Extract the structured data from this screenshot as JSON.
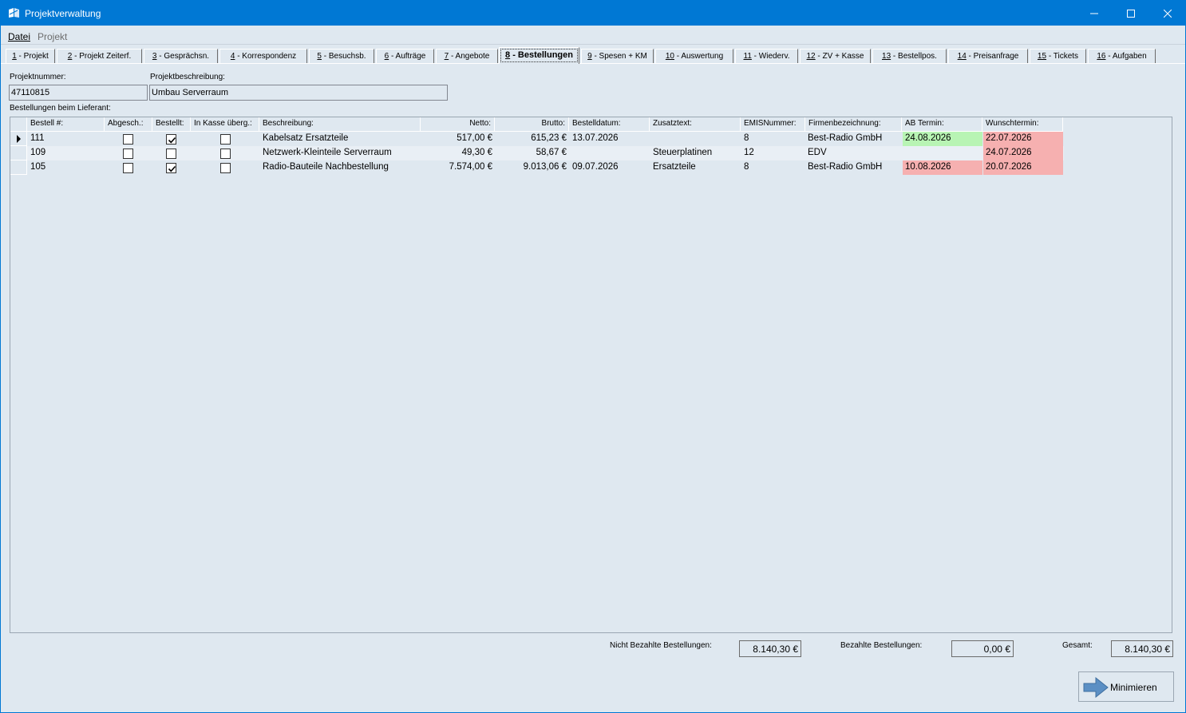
{
  "window": {
    "title": "Projektverwaltung"
  },
  "menu": {
    "datei": "Datei",
    "projekt": "Projekt"
  },
  "tabs": [
    {
      "num": "1",
      "label": " - Projekt"
    },
    {
      "num": "2",
      "label": " - Projekt Zeiterf."
    },
    {
      "num": "3",
      "label": " - Gesprächsn."
    },
    {
      "num": "4",
      "label": " - Korrespondenz"
    },
    {
      "num": "5",
      "label": " - Besuchsb."
    },
    {
      "num": "6",
      "label": " - Aufträge"
    },
    {
      "num": "7",
      "label": " - Angebote"
    },
    {
      "num": "8",
      "label": " - Bestellungen"
    },
    {
      "num": "9",
      "label": " - Spesen + KM"
    },
    {
      "num": "10",
      "label": " - Auswertung"
    },
    {
      "num": "11",
      "label": " - Wiederv."
    },
    {
      "num": "12",
      "label": " - ZV + Kasse"
    },
    {
      "num": "13",
      "label": " - Bestellpos."
    },
    {
      "num": "14",
      "label": " - Preisanfrage"
    },
    {
      "num": "15",
      "label": " - Tickets"
    },
    {
      "num": "16",
      "label": " - Aufgaben"
    }
  ],
  "form": {
    "projektnummer_label": "Projektnummer:",
    "projektnummer": "47110815",
    "beschreibung_label": "Projektbeschreibung:",
    "beschreibung": "Umbau Serverraum",
    "grid_label": "Bestellungen beim Lieferant:"
  },
  "grid": {
    "headers": {
      "bestell": "Bestell #:",
      "abgesch": "Abgesch.:",
      "bestellt": "Bestellt:",
      "kasse": "In Kasse überg.:",
      "beschreibung": "Beschreibung:",
      "netto": "Netto:",
      "brutto": "Brutto:",
      "datum": "Bestelldatum:",
      "zusatz": "Zusatztext:",
      "emis": "EMISNummer:",
      "firma": "Firmenbezeichnung:",
      "ab": "AB Termin:",
      "wunsch": "Wunschtermin:"
    },
    "rows": [
      {
        "bestell": "111",
        "abgesch": false,
        "bestellt": true,
        "kasse": false,
        "beschreibung": "Kabelsatz Ersatzteile",
        "netto": "517,00 €",
        "brutto": "615,23 €",
        "datum": "13.07.2026",
        "zusatz": "",
        "emis": "8",
        "firma": "Best-Radio GmbH",
        "ab": "24.08.2026",
        "ab_status": "green",
        "wunsch": "22.07.2026",
        "wunsch_status": "red"
      },
      {
        "bestell": "109",
        "abgesch": false,
        "bestellt": false,
        "kasse": false,
        "beschreibung": "Netzwerk-Kleinteile Serverraum",
        "netto": "49,30 €",
        "brutto": "58,67 €",
        "datum": "",
        "zusatz": "Steuerplatinen",
        "emis": "12",
        "firma": "EDV",
        "ab": "",
        "ab_status": "none",
        "wunsch": "24.07.2026",
        "wunsch_status": "red"
      },
      {
        "bestell": "105",
        "abgesch": false,
        "bestellt": true,
        "kasse": false,
        "beschreibung": "Radio-Bauteile Nachbestellung",
        "netto": "7.574,00 €",
        "brutto": "9.013,06 €",
        "datum": "09.07.2026",
        "zusatz": "Ersatzteile",
        "emis": "8",
        "firma": "Best-Radio GmbH",
        "ab": "10.08.2026",
        "ab_status": "red",
        "wunsch": "20.07.2026",
        "wunsch_status": "red"
      }
    ]
  },
  "totals": {
    "nicht_bezahlt_label": "Nicht Bezahlte Bestellungen:",
    "nicht_bezahlt": "8.140,30 €",
    "bezahlt_label": "Bezahlte Bestellungen:",
    "bezahlt": "0,00 €",
    "gesamt_label": "Gesamt:",
    "gesamt": "8.140,30 €"
  },
  "buttons": {
    "minimieren": "Minimieren"
  },
  "colors": {
    "titlebar": "#0078d4",
    "background": "#dfe8f0",
    "status_green": "#b8f4b4",
    "status_red": "#f6b0b0",
    "arrow": "#5b8fc4"
  }
}
